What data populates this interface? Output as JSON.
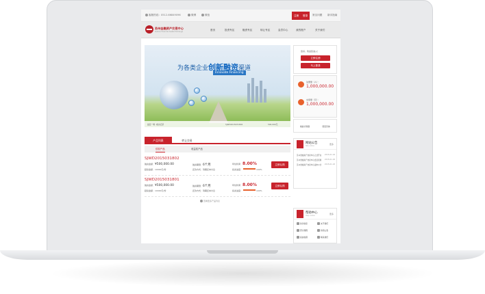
{
  "topbar": {
    "hotline": "客服热线：0512-66849096",
    "weibo": "微博",
    "wechat": "微信",
    "register": "注册",
    "login": "登录",
    "message": "常见问题",
    "novice": "新手指南"
  },
  "logo": {
    "cn": "苏州金融资产交易中心",
    "en": "Suzhou Financial Assets Exchange"
  },
  "nav": {
    "items": [
      "首页",
      "投资专区",
      "融资专区",
      "转让专区",
      "会员中心",
      "我的账户",
      "关于我们"
    ]
  },
  "banner": {
    "title_prefix": "为各类企业",
    "title_highlight": "创新融资",
    "title_suffix": "渠道",
    "subtitle": "Innovate Financing",
    "strip": [
      "最近一笔: 成交记录",
      "SJWD2015031802",
      "500,000元"
    ]
  },
  "login_box": {
    "text": "您好，欢迎您进入！",
    "register_button": "立即注册",
    "login_button": "马上登录"
  },
  "stats": [
    {
      "label": "注册量（人）：",
      "value": "1,000,000.00"
    },
    {
      "label": "交易量（元）：",
      "value": "1,000,000.00"
    }
  ],
  "tools": [
    "收益计算器",
    "项目咨询"
  ],
  "notice": {
    "title": "网站公告",
    "subtitle": "Site notice",
    "more": "更多",
    "rows": [
      {
        "text": "苏州金融资产交易中心正式开业",
        "date": "2015-01-18"
      },
      {
        "text": "苏州金融资产交易中心会员招募",
        "date": "2015-01-18"
      },
      {
        "text": "苏州金融资产交易中心发布公告",
        "date": "2015-01-18"
      }
    ]
  },
  "help": {
    "title": "帮助中心",
    "subtitle": "Help center",
    "more": "更多",
    "items": [
      "新手指引",
      "关于我们",
      "安全保障",
      "新闻公告",
      "投资指南",
      "联系我们"
    ]
  },
  "product_tabs": [
    "产品列表",
    "转让交易"
  ],
  "product_subtabs": [
    "债权产品",
    "收益权产品"
  ],
  "products": [
    {
      "code": "SJWD2015031802",
      "amount_label": "融资金额：",
      "amount": "¥500,000.00",
      "min_label": "起投金额：10000元/份",
      "term_label": "融资期限：",
      "term": "6个月",
      "repay": "还款方式：到期还本付息",
      "rate_label": "年化利率：",
      "rate": "8.00%",
      "progress_label": "投资进度：",
      "progress": 100,
      "progress_text": "100%",
      "button": "立即认购"
    },
    {
      "code": "SJWD2015031801",
      "amount_label": "融资金额：",
      "amount": "¥500,000.00",
      "min_label": "起投金额：10000元/份",
      "term_label": "融资期限：",
      "term": "6个月",
      "repay": "还款方式：到期还本付息",
      "rate_label": "年化利率：",
      "rate": "8.00%",
      "progress_label": "投资进度：",
      "progress": 100,
      "progress_text": "100%",
      "button": "立即认购"
    }
  ],
  "more_products": "查看更多产品列表",
  "colors": {
    "accent": "#c8232c",
    "orange": "#e8612c"
  }
}
